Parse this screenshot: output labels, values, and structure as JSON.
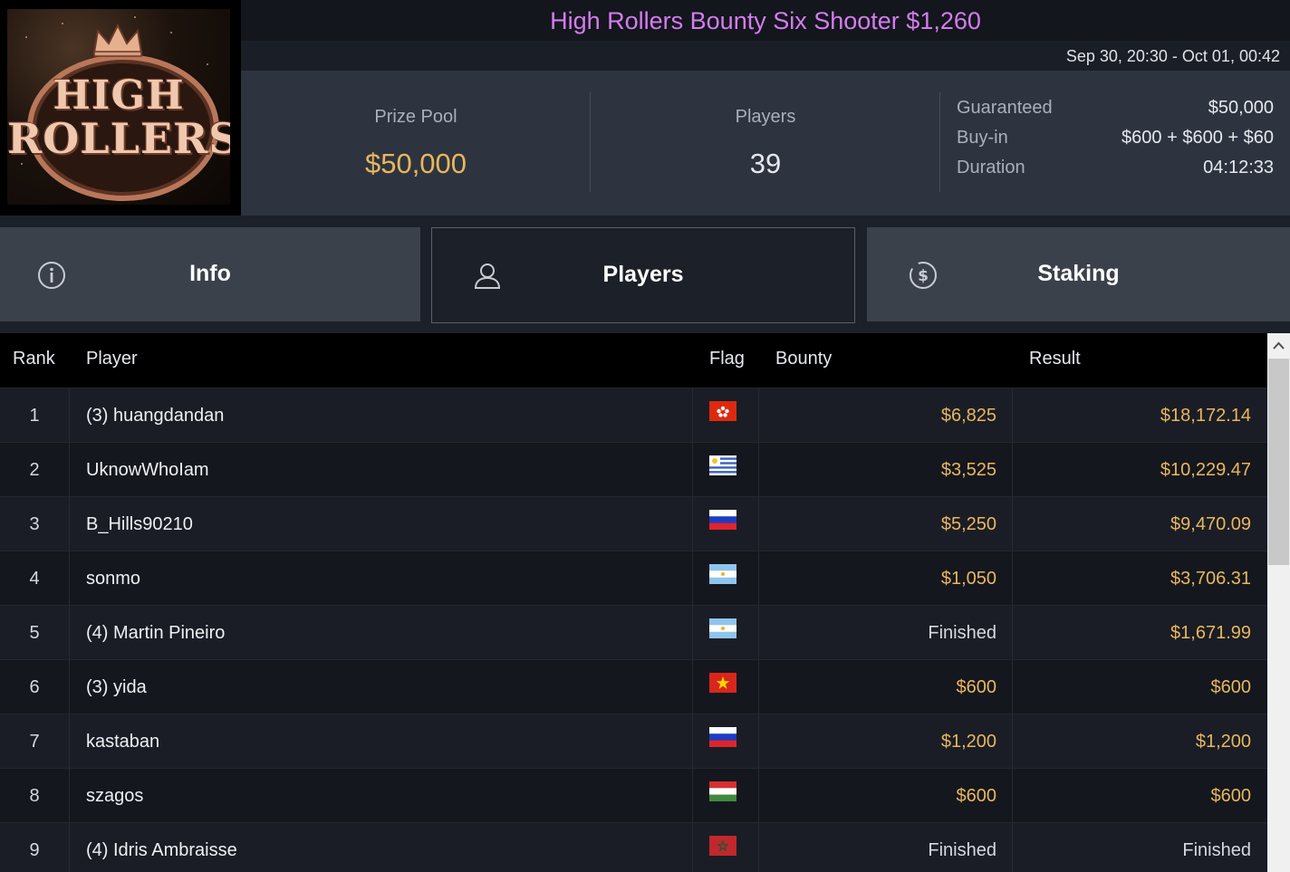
{
  "header": {
    "title": "High Rollers Bounty Six Shooter $1,260",
    "date_range": "Sep 30, 20:30 - Oct 01, 00:42",
    "logo_text_line1": "HIGH",
    "logo_text_line2": "ROLLERS"
  },
  "stats": {
    "prize_pool_label": "Prize Pool",
    "prize_pool_value": "$50,000",
    "players_label": "Players",
    "players_value": "39",
    "guaranteed_label": "Guaranteed",
    "guaranteed_value": "$50,000",
    "buyin_label": "Buy-in",
    "buyin_value": "$600 + $600 + $60",
    "duration_label": "Duration",
    "duration_value": "04:12:33"
  },
  "tabs": [
    {
      "label": "Info",
      "icon": "info-icon"
    },
    {
      "label": "Players",
      "icon": "user-icon",
      "active": true
    },
    {
      "label": "Staking",
      "icon": "dollar-coin-icon"
    }
  ],
  "table": {
    "headers": {
      "rank": "Rank",
      "player": "Player",
      "flag": "Flag",
      "bounty": "Bounty",
      "result": "Result"
    },
    "rows": [
      {
        "rank": "1",
        "player": "(3) huangdandan",
        "flag": "hong-kong",
        "bounty": "$6,825",
        "result": "$18,172.14"
      },
      {
        "rank": "2",
        "player": "UknowWhoIam",
        "flag": "uruguay",
        "bounty": "$3,525",
        "result": "$10,229.47"
      },
      {
        "rank": "3",
        "player": "B_Hills90210",
        "flag": "russia",
        "bounty": "$5,250",
        "result": "$9,470.09"
      },
      {
        "rank": "4",
        "player": "sonmo",
        "flag": "argentina",
        "bounty": "$1,050",
        "result": "$3,706.31"
      },
      {
        "rank": "5",
        "player": "(4) Martin Pineiro",
        "flag": "argentina",
        "bounty": "Finished",
        "result": "$1,671.99"
      },
      {
        "rank": "6",
        "player": "(3) yida",
        "flag": "vietnam",
        "bounty": "$600",
        "result": "$600"
      },
      {
        "rank": "7",
        "player": "kastaban",
        "flag": "russia",
        "bounty": "$1,200",
        "result": "$1,200"
      },
      {
        "rank": "8",
        "player": "szagos",
        "flag": "hungary",
        "bounty": "$600",
        "result": "$600"
      },
      {
        "rank": "9",
        "player": "(4) Idris Ambraisse",
        "flag": "morocco",
        "bounty": "Finished",
        "result": "Finished"
      }
    ]
  },
  "colors": {
    "title": "#d57cf0",
    "money": "#e8b75e",
    "panel": "#2e343f",
    "tab": "#3b414b"
  }
}
